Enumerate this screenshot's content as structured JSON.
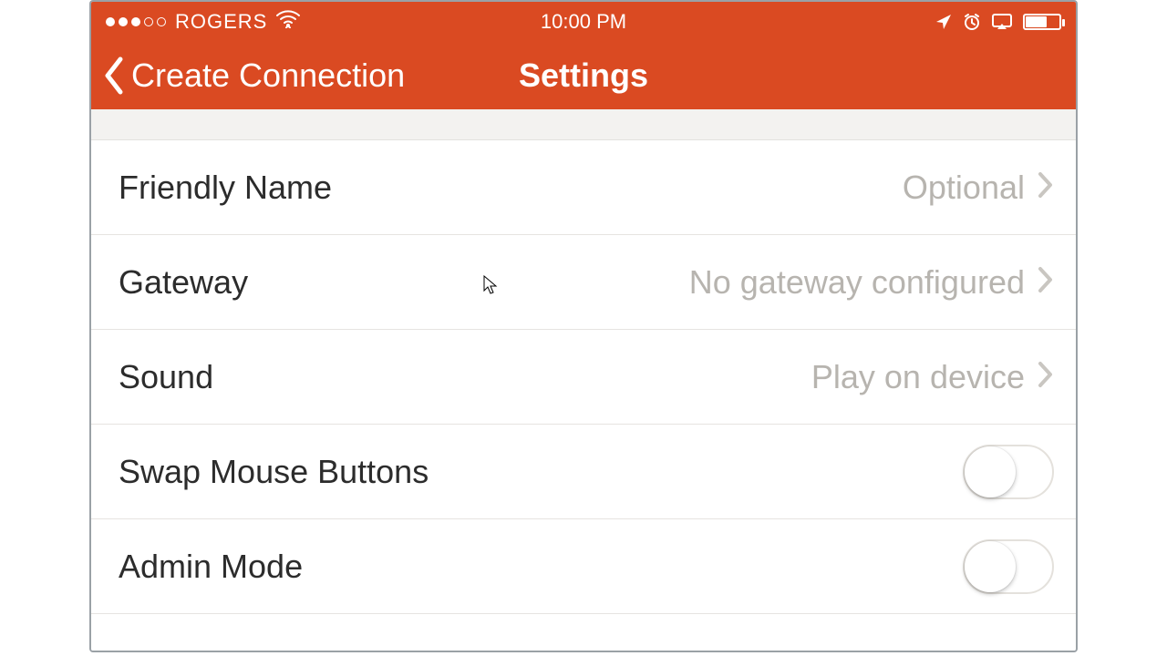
{
  "statusbar": {
    "carrier": "ROGERS",
    "time": "10:00 PM",
    "signal_filled": 3,
    "signal_total": 5,
    "icons": [
      "location-icon",
      "alarm-icon",
      "airplay-icon",
      "battery-icon"
    ]
  },
  "navbar": {
    "back_label": "Create Connection",
    "title": "Settings"
  },
  "rows": [
    {
      "label": "Friendly Name",
      "value": "Optional",
      "type": "detail"
    },
    {
      "label": "Gateway",
      "value": "No gateway configured",
      "type": "detail"
    },
    {
      "label": "Sound",
      "value": "Play on device",
      "type": "detail"
    },
    {
      "label": "Swap Mouse Buttons",
      "value": "",
      "type": "toggle",
      "on": false
    },
    {
      "label": "Admin Mode",
      "value": "",
      "type": "toggle",
      "on": false
    }
  ]
}
